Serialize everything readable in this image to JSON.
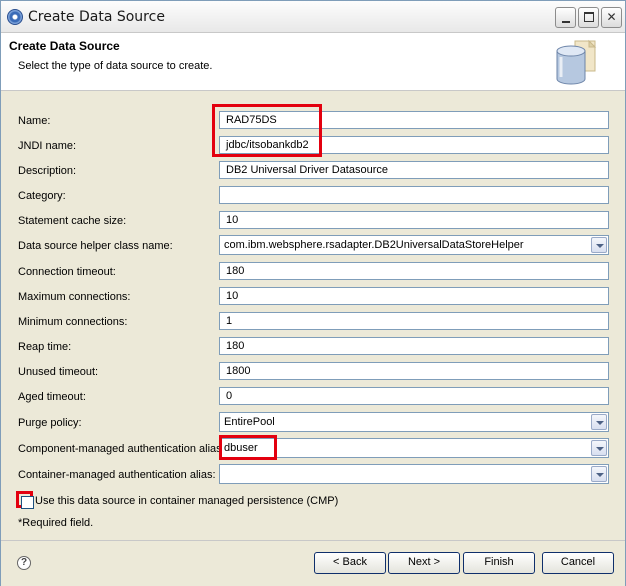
{
  "window": {
    "title": "Create Data Source"
  },
  "header": {
    "title": "Create Data Source",
    "description": "Select the type of data source to create."
  },
  "fields": {
    "name": {
      "label": "Name:",
      "value": "RAD75DS"
    },
    "jndi": {
      "label": "JNDI name:",
      "value": "jdbc/itsobankdb2"
    },
    "description": {
      "label": "Description:",
      "value": "DB2 Universal Driver Datasource"
    },
    "category": {
      "label": "Category:",
      "value": ""
    },
    "statement_cache": {
      "label": "Statement cache size:",
      "value": "10"
    },
    "helper_class": {
      "label": "Data source helper class name:",
      "value": "com.ibm.websphere.rsadapter.DB2UniversalDataStoreHelper"
    },
    "connection_timeout": {
      "label": "Connection timeout:",
      "value": "180"
    },
    "max_connections": {
      "label": "Maximum connections:",
      "value": "10"
    },
    "min_connections": {
      "label": "Minimum connections:",
      "value": "1"
    },
    "reap_time": {
      "label": "Reap time:",
      "value": "180"
    },
    "unused_timeout": {
      "label": "Unused timeout:",
      "value": "1800"
    },
    "aged_timeout": {
      "label": "Aged timeout:",
      "value": "0"
    },
    "purge_policy": {
      "label": "Purge policy:",
      "value": "EntirePool"
    },
    "component_auth": {
      "label": "Component-managed authentication alias:",
      "value": "dbuser"
    },
    "container_auth": {
      "label": "Container-managed authentication alias:",
      "value": ""
    }
  },
  "cmp": {
    "label": "Use this data source in container managed persistence (CMP)",
    "checked": false
  },
  "required_note": "*Required field.",
  "buttons": {
    "back": "< Back",
    "next": "Next >",
    "finish": "Finish",
    "cancel": "Cancel"
  },
  "icons": {
    "app": "eclipse-icon",
    "header": "database-icon",
    "help": "help-icon"
  },
  "colors": {
    "highlight": "#e3000f",
    "input_border": "#7f9db9",
    "dialog_bg": "#ece9d8"
  }
}
